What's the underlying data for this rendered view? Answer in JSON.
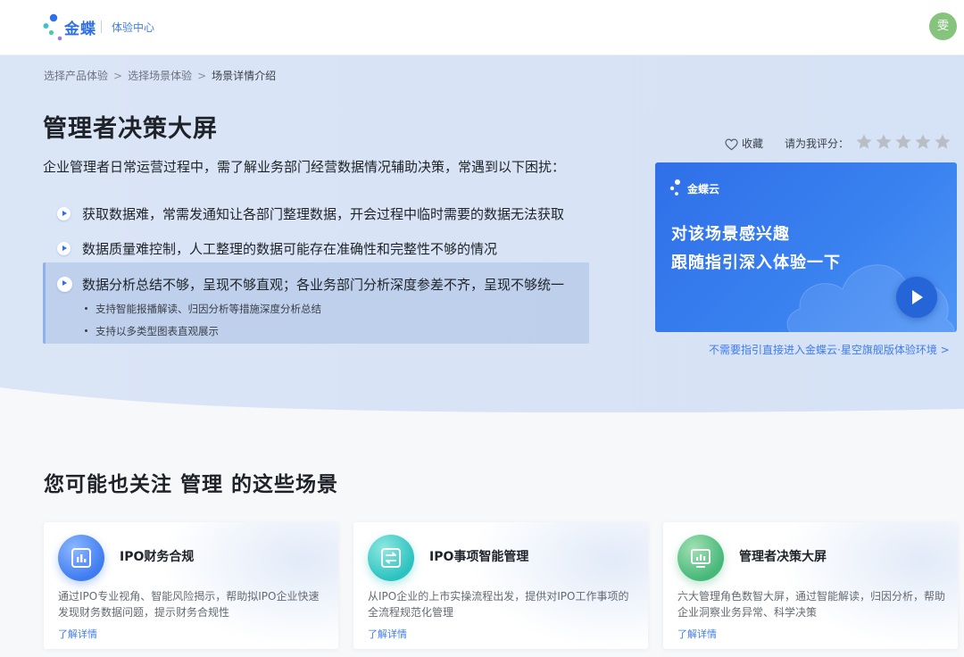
{
  "header": {
    "brand": "金蝶",
    "subtitle": "体验中心",
    "avatar_text": "雯"
  },
  "breadcrumb": {
    "items": [
      "选择产品体验",
      "选择场景体验",
      "场景详情介绍"
    ],
    "separator": ">"
  },
  "scenario": {
    "title": "管理者决策大屏",
    "intro": "企业管理者日常运营过程中，需了解业务部门经营数据情况辅助决策，常遇到以下困扰：",
    "pain_points": [
      "获取数据难，常需发通知让各部门整理数据，开会过程中临时需要的数据无法获取",
      "数据质量难控制，人工整理的数据可能存在准确性和完整性不够的情况",
      "数据分析总结不够，呈现不够直观；各业务部门分析深度参差不齐，呈现不够统一"
    ],
    "active_sub_items": [
      "支持智能报播解读、归因分析等措施深度分析总结",
      "支持以多类型图表直观展示"
    ]
  },
  "actions": {
    "favorite_label": "收藏",
    "rating_label": "请为我评分：",
    "rating": {
      "value": 0,
      "max": 5
    }
  },
  "promo": {
    "brand": "金蝶云",
    "line1": "对该场景感兴趣",
    "line2": "跟随指引深入体验一下",
    "direct_link": "不需要指引直接进入金蝶云·星空旗舰版体验环境 >"
  },
  "related": {
    "title": "您可能也关注 管理 的这些场景",
    "cards": [
      {
        "title": "IPO财务合规",
        "desc": "通过IPO专业视角、智能风险揭示，帮助拟IPO企业快速发现财务数据问题，提示财务合规性",
        "link": "了解详情",
        "icon": "bar-chart-icon"
      },
      {
        "title": "IPO事项智能管理",
        "desc": "从IPO企业的上市实操流程出发，提供对IPO工作事项的全流程规范化管理",
        "link": "了解详情",
        "icon": "switch-icon"
      },
      {
        "title": "管理者决策大屏",
        "desc": "六大管理角色数智大屏，通过智能解读，归因分析，帮助企业洞察业务异常、科学决策",
        "link": "了解详情",
        "icon": "dashboard-icon"
      }
    ]
  },
  "colors": {
    "accent": "#2f6fe8",
    "hero_bg": "#dbe6f6",
    "page_bg": "#f7f8fa",
    "avatar": "#86c47d"
  }
}
